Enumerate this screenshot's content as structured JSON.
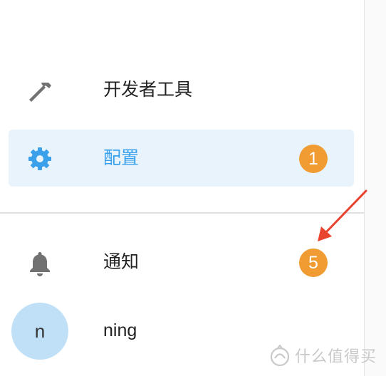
{
  "sidebar": {
    "items": [
      {
        "label": "开发者工具",
        "icon": "hammer-icon"
      },
      {
        "label": "配置",
        "icon": "gear-icon",
        "badge": "1",
        "selected": true
      },
      {
        "label": "通知",
        "icon": "bell-icon",
        "badge": "5"
      }
    ],
    "user": {
      "avatar_letter": "n",
      "name": "ning"
    }
  },
  "watermark": {
    "text": "什么值得买",
    "icon": "smzdm-logo-icon"
  },
  "colors": {
    "accent": "#3aa0ea",
    "selected_bg": "#e8f3fc",
    "badge": "#f19b33",
    "icon_gray": "#727272",
    "avatar_bg": "#bfe0f7",
    "annotation_arrow": "#e8432f"
  }
}
